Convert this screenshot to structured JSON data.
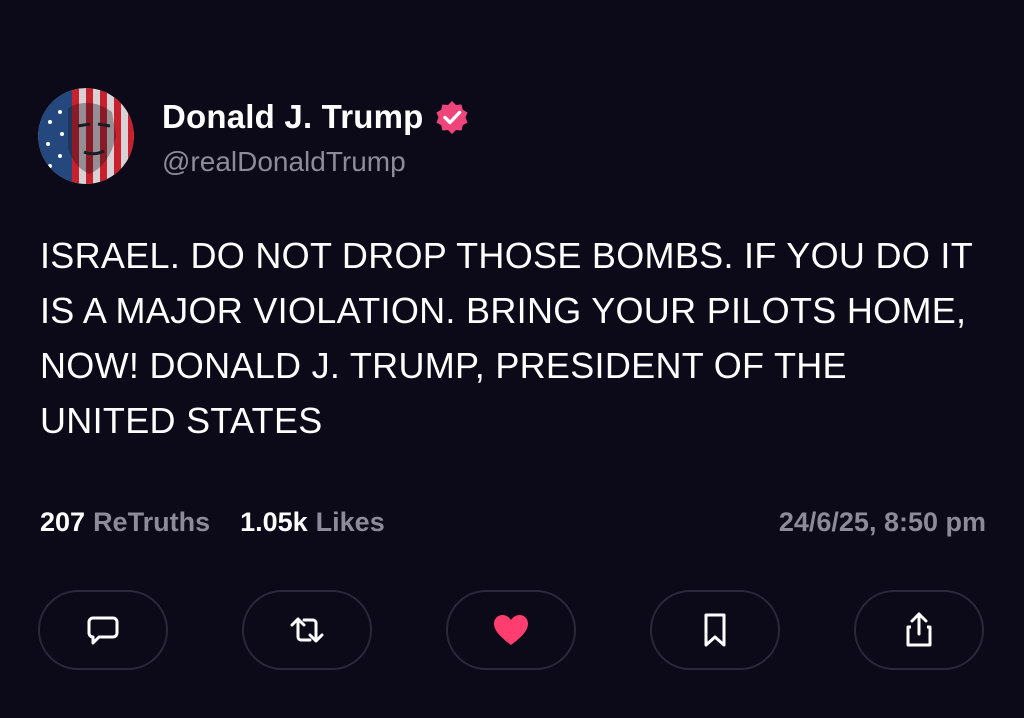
{
  "post": {
    "author": {
      "display_name": "Donald J. Trump",
      "handle": "@realDonaldTrump",
      "verified": true,
      "verified_color": "#f0457a"
    },
    "text": "ISRAEL. DO NOT DROP THOSE BOMBS. IF YOU DO IT IS A MAJOR VIOLATION. BRING YOUR PILOTS HOME, NOW! DONALD J. TRUMP, PRESIDENT OF THE UNITED STATES",
    "stats": {
      "retruths_count": "207",
      "retruths_label": "ReTruths",
      "likes_count": "1.05k",
      "likes_label": "Likes"
    },
    "timestamp": "24/6/25, 8:50 pm"
  },
  "actions": [
    {
      "name": "reply",
      "icon": "comment-icon"
    },
    {
      "name": "retruth",
      "icon": "repost-icon"
    },
    {
      "name": "like",
      "icon": "heart-icon",
      "active": true,
      "color": "#ff3d6e"
    },
    {
      "name": "bookmark",
      "icon": "bookmark-icon"
    },
    {
      "name": "share",
      "icon": "share-icon"
    }
  ],
  "theme": {
    "background": "#0c0919",
    "text_primary": "#ffffff",
    "text_secondary": "#8d8a99",
    "button_border": "#2b283a"
  }
}
